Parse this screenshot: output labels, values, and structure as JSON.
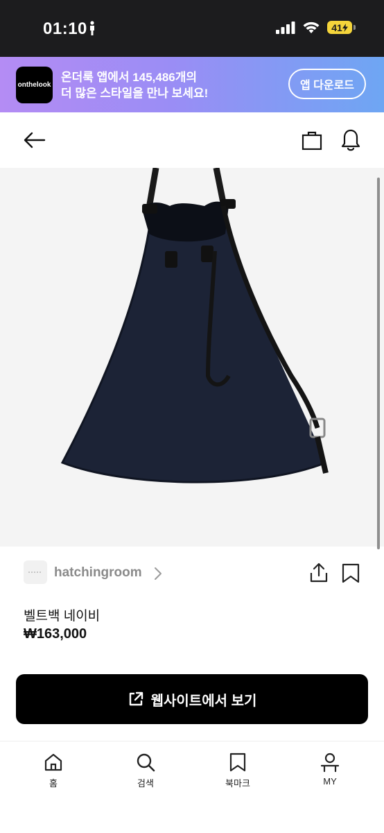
{
  "status_bar": {
    "time": "01:10",
    "battery": "41"
  },
  "promo": {
    "logo_text": "onthelook",
    "line1": "온더룩 앱에서 145,486개의",
    "line2": "더 많은 스타일을 만나 보세요!",
    "button_label": "앱 다운로드"
  },
  "nav": {
    "icons": [
      "back-arrow-icon",
      "shopping-bag-icon",
      "bell-icon"
    ]
  },
  "product": {
    "image_alt": "navy drawstring belt bag with black leather strap",
    "brand_name": "hatchingroom",
    "name": "벨트백 네이비",
    "price": "₩163,000",
    "cta_label": "웹사이트에서 보기"
  },
  "tabbar": {
    "items": [
      {
        "label": "홈",
        "icon": "home-icon"
      },
      {
        "label": "검색",
        "icon": "search-icon"
      },
      {
        "label": "북마크",
        "icon": "bookmark-icon"
      },
      {
        "label": "MY",
        "icon": "profile-icon"
      }
    ]
  },
  "colors": {
    "promo_gradient_start": "#b48cf4",
    "promo_gradient_end": "#6ea6f3",
    "cta_background": "#000000",
    "status_bar": "#1c1c1e",
    "battery": "#f5d53b"
  }
}
